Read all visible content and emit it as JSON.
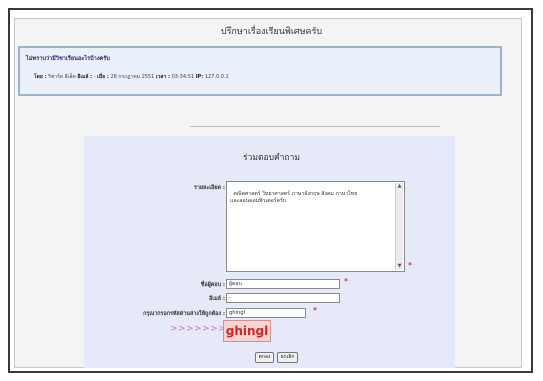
{
  "page": {
    "title": "ปรึกษาเรื่องเรียนพิเศษครับ"
  },
  "topic": {
    "header": "ไม่ทราบว่ามีวิชาเรียนอะไรบ้างครับ",
    "by_label": "โดย :",
    "by_value": "ริชาร์ด อีเล็ค",
    "email_label": "อีเมล์ :",
    "email_value": "-",
    "date_label": "เมื่อ :",
    "date_value": "28 กรกฎาคม 2551",
    "time_label": "เวลา :",
    "time_value": "03:34:51",
    "ip_label": "IP:",
    "ip_value": "127.0.0.1"
  },
  "reply": {
    "title": "ร่วมตอบคำถาม",
    "details_label": "รายละเอียด :",
    "details_value": "คณิตศาสตร์ วิทยาศาสตร์ ภาษาอังกฤษ สังคม ภาษาไทย\nและสอนคอมพิวเตอร์ครับ",
    "name_label": "ชื่อผู้ตอบ :",
    "name_value": "ผู้ตอบ",
    "email_label": "อีเมล์ :",
    "email_value": "-",
    "captcha_label": "กรุณากรอกรหัสด่านล่างให้ถูกต้อง :",
    "captcha_value": "ghingl",
    "captcha_arrows": ">>>>>>>>>",
    "captcha_image_text": "ghingl",
    "required_mark": "*",
    "submit_label": "ตกลง",
    "reset_label": "ยกเลิก"
  }
}
